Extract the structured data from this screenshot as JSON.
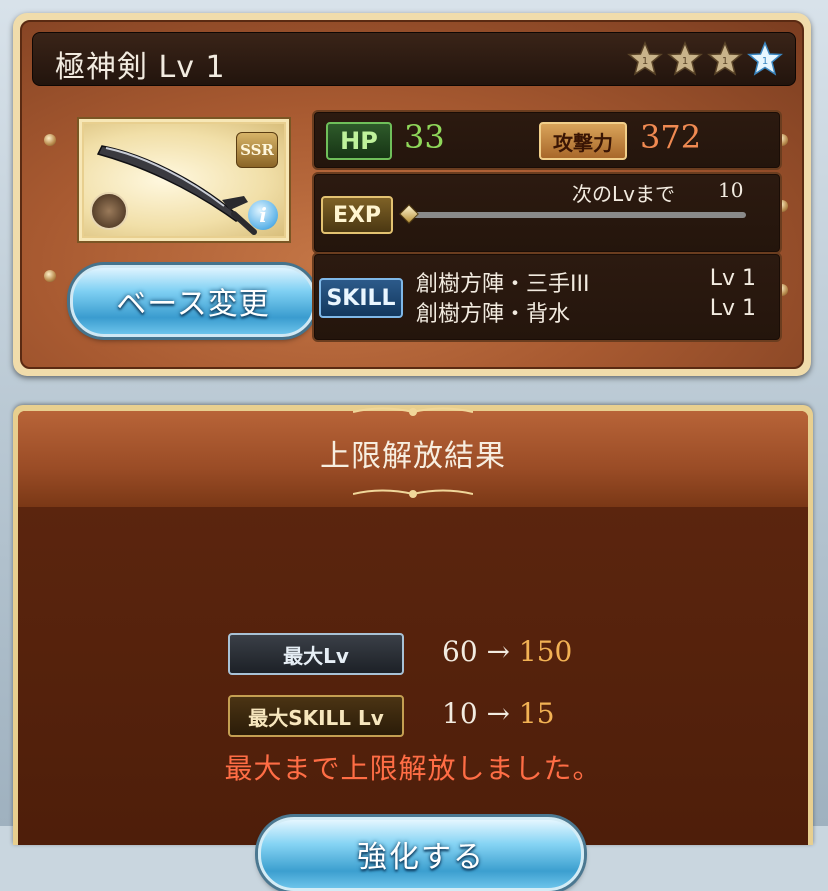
{
  "weapon": {
    "title": "極神剣 Lv 1",
    "rarity": "SSR",
    "stars_filled": 3,
    "stars_total": 4,
    "element_icon": "element-icon",
    "info_icon": "i"
  },
  "stats": {
    "hp_label": "HP",
    "hp_value": "33",
    "atk_label": "攻撃力",
    "atk_value": "372"
  },
  "exp": {
    "label": "EXP",
    "next_label": "次のLvまで",
    "next_value": "10",
    "progress": 0
  },
  "skill": {
    "label": "SKILL",
    "items": [
      {
        "name": "創樹方陣・三手III",
        "level": "Lv 1"
      },
      {
        "name": "創樹方陣・背水",
        "level": "Lv 1"
      }
    ]
  },
  "buttons": {
    "base_change": "ベース変更",
    "enhance": "強化する"
  },
  "result": {
    "title": "上限解放結果",
    "max_lv_label": "最大Lv",
    "max_lv_from": "60",
    "max_lv_to": "150",
    "max_skill_label": "最大SKILL Lv",
    "max_skill_from": "10",
    "max_skill_to": "15",
    "arrow": "→",
    "message": "最大まで上限解放しました。"
  },
  "colors": {
    "hp_value": "#8fd85a",
    "atk_value": "#f08a52",
    "result_to": "#f2b254",
    "message": "#ff6d45"
  }
}
